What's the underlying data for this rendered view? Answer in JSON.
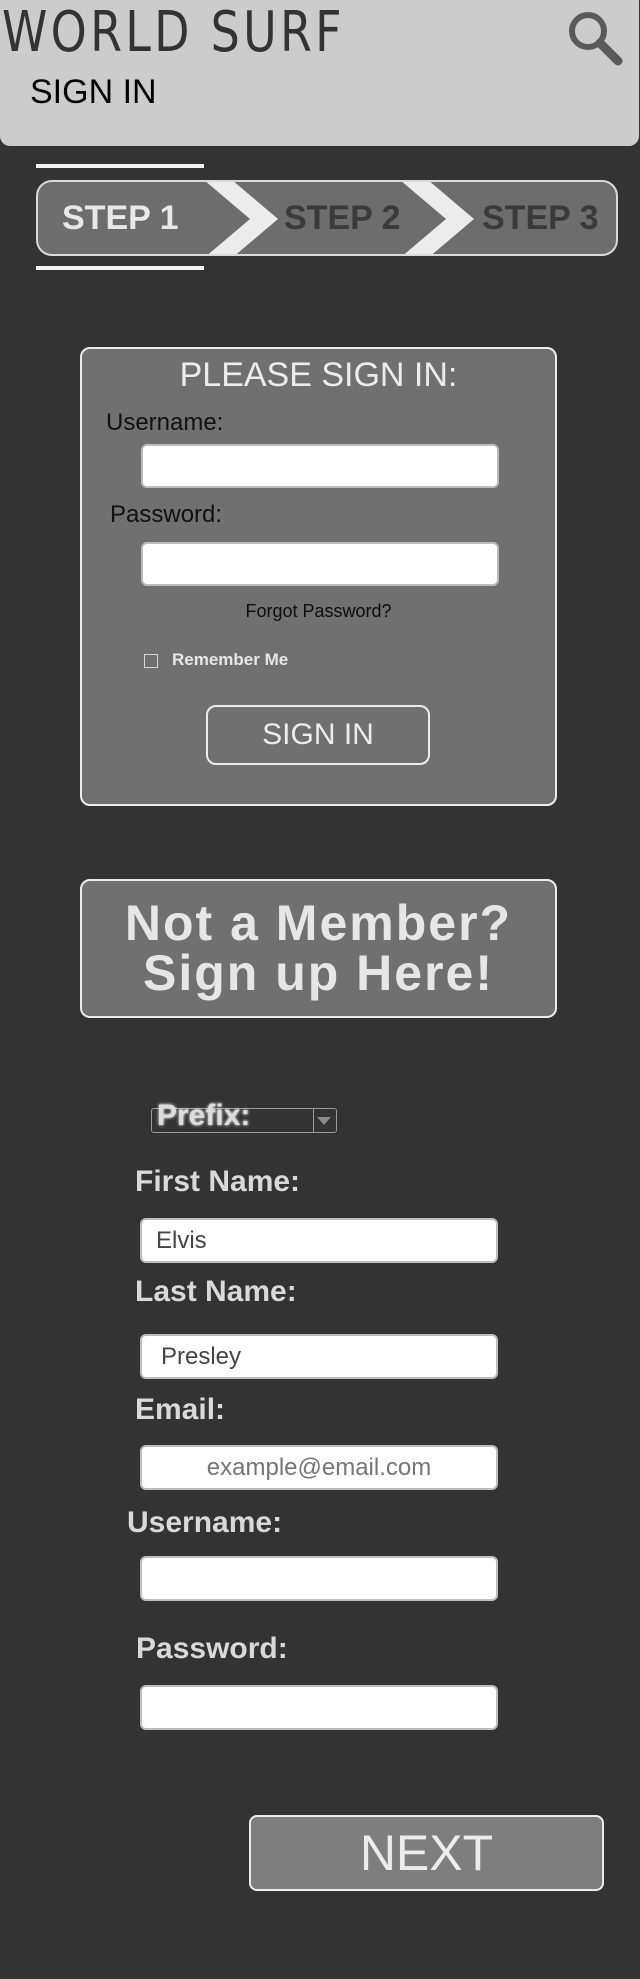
{
  "header": {
    "brand": "WORLD SURF",
    "page_title": "SIGN IN"
  },
  "steps": {
    "items": [
      {
        "label": "STEP 1",
        "state": "active"
      },
      {
        "label": "STEP 2",
        "state": "inactive"
      },
      {
        "label": "STEP 3",
        "state": "inactive"
      }
    ]
  },
  "login": {
    "heading": "PLEASE SIGN IN:",
    "username_label": "Username:",
    "username_value": "",
    "password_label": "Password:",
    "password_value": "",
    "forgot_password": "Forgot Password?",
    "remember_me": "Remember Me",
    "remember_checked": false,
    "submit_label": "SIGN IN"
  },
  "signup_banner": {
    "line1": "Not a Member?",
    "line2": "Sign up Here!"
  },
  "register": {
    "prefix_label": "Prefix:",
    "prefix_value": "",
    "first_name_label": "First Name:",
    "first_name_value": "Elvis",
    "last_name_label": "Last Name:",
    "last_name_value": "Presley",
    "email_label": "Email:",
    "email_placeholder": "example@email.com",
    "username_label": "Username:",
    "username_value": "",
    "password_label": "Password:",
    "password_value": "",
    "next_label": "NEXT"
  },
  "icons": {
    "search": "search-icon",
    "step_separator": "chevron-right-icon",
    "dropdown": "chevron-down-icon"
  },
  "colors": {
    "background": "#333333",
    "header": "#cccccc",
    "panel": "#707070",
    "border": "#ececec"
  }
}
